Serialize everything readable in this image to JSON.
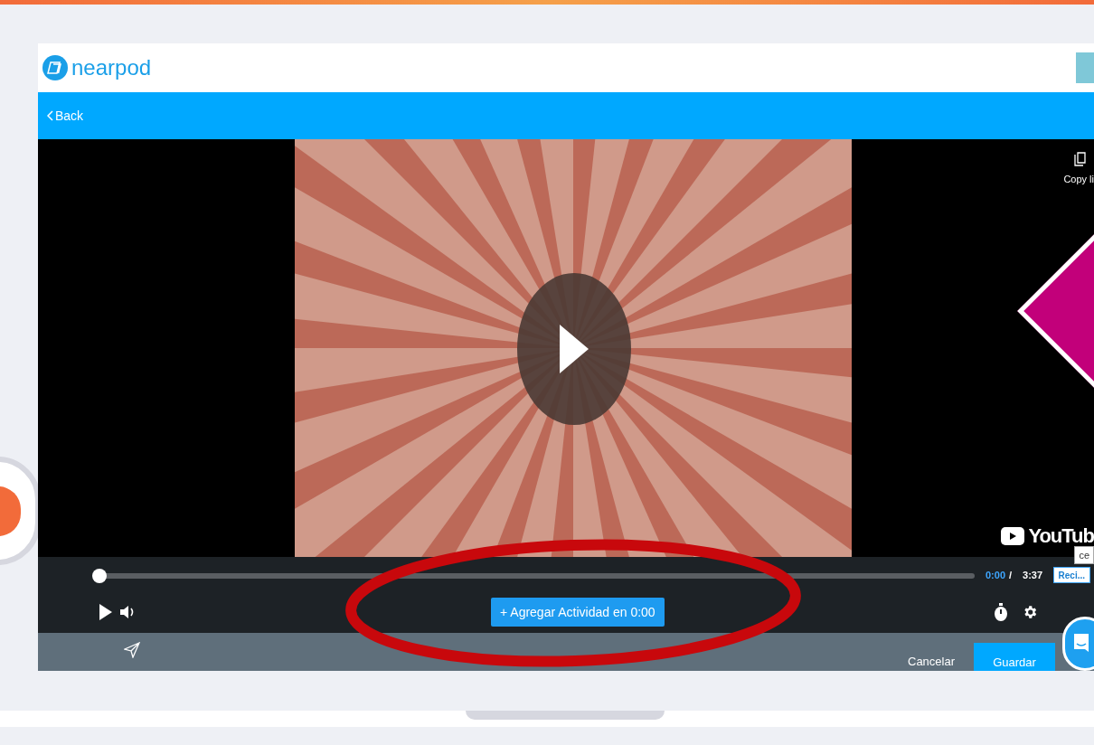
{
  "brand": {
    "name": "nearpod"
  },
  "nav": {
    "back": "Back"
  },
  "video": {
    "copy_link": "Copy li",
    "logo": "YouTub",
    "tooltip": "ce"
  },
  "player": {
    "level": 0,
    "current_time": "0:00",
    "separator": "/",
    "duration": "3:37",
    "side_button": "Reci...",
    "add_activity": "+ Agregar Actividad en 0:00"
  },
  "footer": {
    "cancel": "Cancelar",
    "save": "Guardar"
  }
}
